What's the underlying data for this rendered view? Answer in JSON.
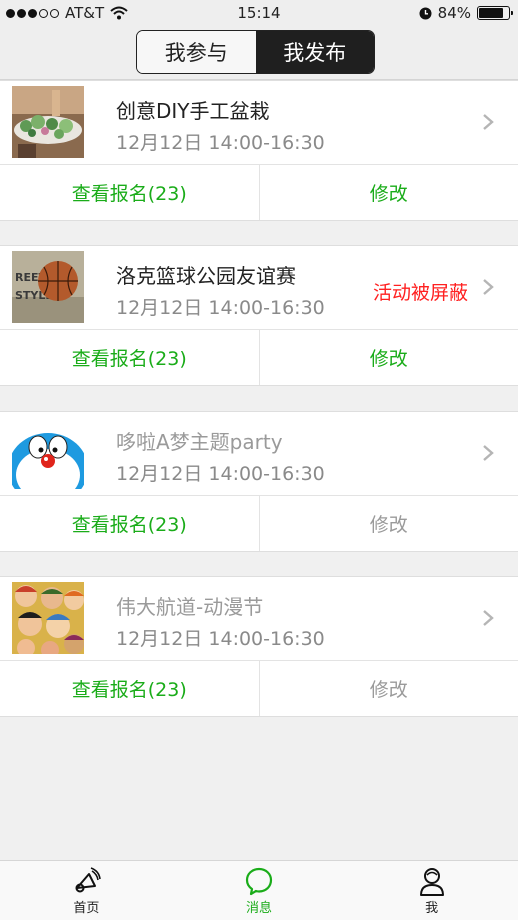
{
  "status_bar": {
    "carrier": "AT&T",
    "time": "15:14",
    "battery": "84%",
    "signal_bars": 3,
    "battery_level": 0.84
  },
  "segment": {
    "tabs": [
      {
        "label": "我参与",
        "active": false
      },
      {
        "label": "我发布",
        "active": true
      }
    ]
  },
  "events": [
    {
      "title": "创意DIY手工盆栽",
      "time": "12月12日  14:00-16:30",
      "status": "",
      "view_label": "查看报名(23)",
      "edit_label": "修改",
      "thumb": "plant-thumbnail"
    },
    {
      "title": "洛克篮球公园友谊赛",
      "time": "12月12日  14:00-16:30",
      "status": "活动被屏蔽",
      "view_label": "查看报名(23)",
      "edit_label": "修改",
      "thumb": "basketball-thumbnail"
    },
    {
      "title": "哆啦A梦主题party",
      "time": "12月12日  14:00-16:30",
      "status": "",
      "view_label": "查看报名(23)",
      "edit_label": "修改",
      "thumb": "doraemon-thumbnail"
    },
    {
      "title": "伟大航道-动漫节",
      "time": "12月12日  14:00-16:30",
      "status": "",
      "view_label": "查看报名(23)",
      "edit_label": "修改",
      "thumb": "onepiece-thumbnail"
    }
  ],
  "tabbar": {
    "items": [
      {
        "label": "首页",
        "icon": "megaphone-icon",
        "active": false
      },
      {
        "label": "消息",
        "icon": "chat-bubble-icon",
        "active": true
      },
      {
        "label": "我",
        "icon": "user-icon",
        "active": false
      }
    ]
  },
  "colors": {
    "accent_green": "#1aac19",
    "blocked_red": "#ff2020",
    "disabled_gray": "#9a9a9a"
  }
}
